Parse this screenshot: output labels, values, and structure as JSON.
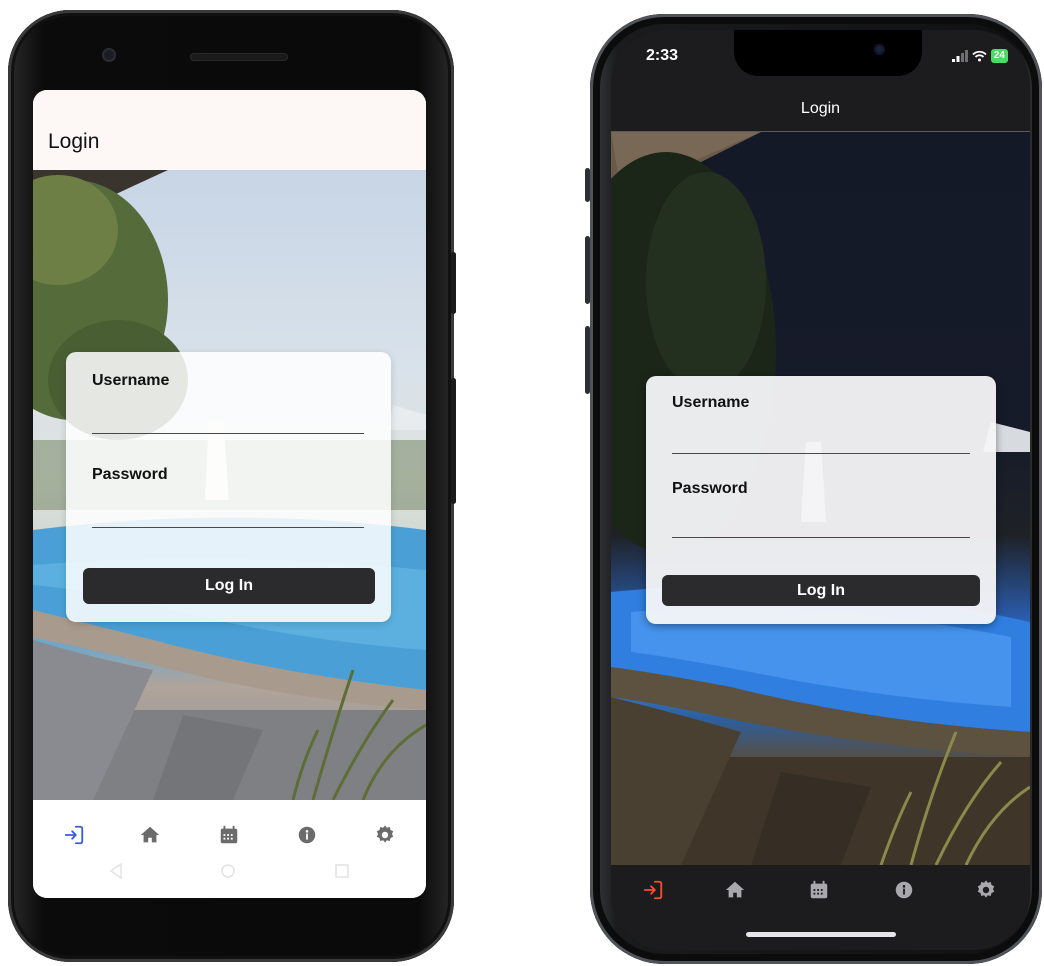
{
  "android": {
    "header_title": "Login",
    "form": {
      "username_label": "Username",
      "password_label": "Password",
      "login_button": "Log In"
    },
    "tabs": [
      "login-icon",
      "home-icon",
      "calendar-icon",
      "info-icon",
      "settings-icon"
    ],
    "active_tab": "login-icon",
    "active_color": "#3b5bdb",
    "icon_color": "#6b6b6b"
  },
  "iphone": {
    "status_time": "2:33",
    "battery": "24",
    "header_title": "Login",
    "form": {
      "username_label": "Username",
      "password_label": "Password",
      "login_button": "Log In"
    },
    "tabs": [
      "login-icon",
      "home-icon",
      "calendar-icon",
      "info-icon",
      "settings-icon"
    ],
    "active_tab": "login-icon",
    "active_color": "#ff4b2b",
    "icon_color": "#a8a8ad"
  }
}
